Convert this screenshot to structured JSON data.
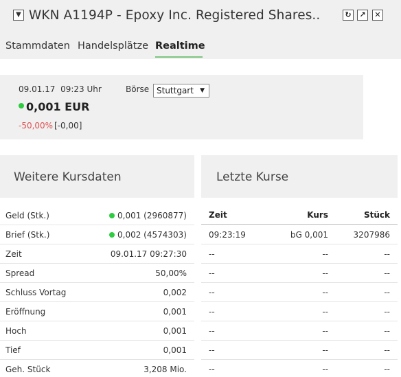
{
  "header": {
    "collapse_glyph": "▼",
    "title": "WKN A1194P - Epoxy Inc. Registered Shares..",
    "buttons": [
      {
        "name": "refresh-icon",
        "glyph": "↻"
      },
      {
        "name": "popout-icon",
        "glyph": "↗"
      },
      {
        "name": "close-icon",
        "glyph": "✕"
      }
    ]
  },
  "tabs": [
    {
      "label": "Stammdaten",
      "active": false
    },
    {
      "label": "Handelsplätze",
      "active": false
    },
    {
      "label": "Realtime",
      "active": true
    }
  ],
  "quote": {
    "date": "09.01.17",
    "time": "09:23 Uhr",
    "boerse_label": "Börse",
    "boerse_selected": "Stuttgart",
    "price": "0,001 EUR",
    "change_pct": "-50,00%",
    "change_abs": "[-0,00]",
    "status_color": "#2ecc40",
    "negative_color": "#e05050"
  },
  "weitere_kursdaten": {
    "title": "Weitere Kursdaten",
    "rows": [
      {
        "label": "Geld (Stk.)",
        "value": "0,001 (2960877)",
        "dot": true
      },
      {
        "label": "Brief (Stk.)",
        "value": "0,002 (4574303)",
        "dot": true
      },
      {
        "label": "Zeit",
        "value": "09.01.17 09:27:30",
        "dot": false
      },
      {
        "label": "Spread",
        "value": "50,00%",
        "dot": false
      },
      {
        "label": "Schluss Vortag",
        "value": "0,002",
        "dot": false
      },
      {
        "label": "Eröffnung",
        "value": "0,001",
        "dot": false
      },
      {
        "label": "Hoch",
        "value": "0,001",
        "dot": false
      },
      {
        "label": "Tief",
        "value": "0,001",
        "dot": false
      },
      {
        "label": "Geh. Stück",
        "value": "3,208 Mio.",
        "dot": false
      }
    ]
  },
  "letzte_kurse": {
    "title": "Letzte Kurse",
    "columns": [
      "Zeit",
      "Kurs",
      "Stück"
    ],
    "rows": [
      [
        "09:23:19",
        "bG 0,001",
        "3207986"
      ],
      [
        "--",
        "--",
        "--"
      ],
      [
        "--",
        "--",
        "--"
      ],
      [
        "--",
        "--",
        "--"
      ],
      [
        "--",
        "--",
        "--"
      ],
      [
        "--",
        "--",
        "--"
      ],
      [
        "--",
        "--",
        "--"
      ],
      [
        "--",
        "--",
        "--"
      ]
    ]
  }
}
